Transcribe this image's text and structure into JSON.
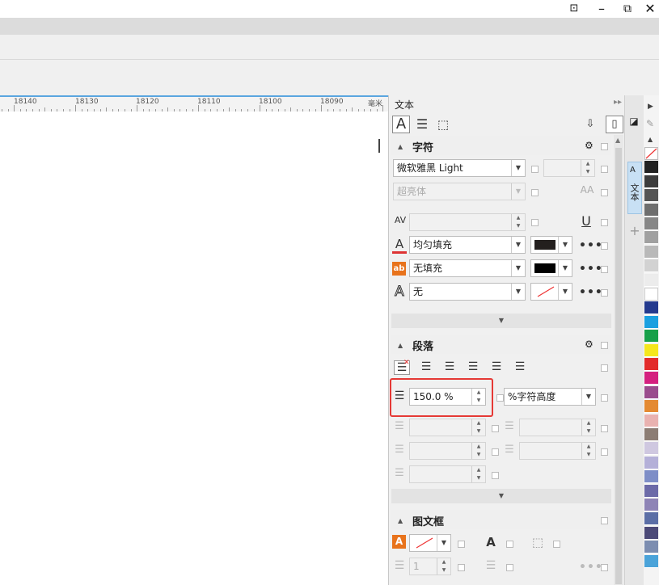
{
  "ruler": {
    "labels": [
      "18140",
      "18130",
      "18120",
      "18110",
      "18100",
      "18090",
      "毫米"
    ]
  },
  "docker": {
    "title": "文本",
    "character": {
      "title": "字符",
      "font_family": "微软雅黑 Light",
      "font_style": "超亮体",
      "fill_type": "均匀填充",
      "fill_color": "#231f1e",
      "bg_fill_type": "无填充",
      "bg_fill_color": "#000000",
      "outline": "无"
    },
    "paragraph": {
      "title": "段落",
      "line_spacing": "150.0 %",
      "line_spacing_unit": "%字符高度"
    },
    "frame": {
      "title": "图文框",
      "columns": "1"
    }
  },
  "side_tab": {
    "label": "文本"
  },
  "palette": [
    "#ffffff",
    "#222222",
    "#3c3c3c",
    "#555555",
    "#6e6e6e",
    "#878787",
    "#a0a0a0",
    "#b9b9b9",
    "#d2d2d2",
    "#ececec",
    "#ffffff",
    "#243a8e",
    "#1aa0e0",
    "#17a04a",
    "#f5e61d",
    "#e22b2a",
    "#d4207f",
    "#9a4c8d",
    "#e48a32",
    "#e9b2b0",
    "#8c7d74",
    "#cfc8e0",
    "#b4b0d8",
    "#7e8ec7",
    "#6c6aa8",
    "#8e84b6",
    "#5b6ea6",
    "#4c4a78",
    "#7c8db0",
    "#4aa3d9"
  ],
  "colors": {
    "highlight": "#e53935",
    "ruler_accent": "#5aa6e0"
  }
}
